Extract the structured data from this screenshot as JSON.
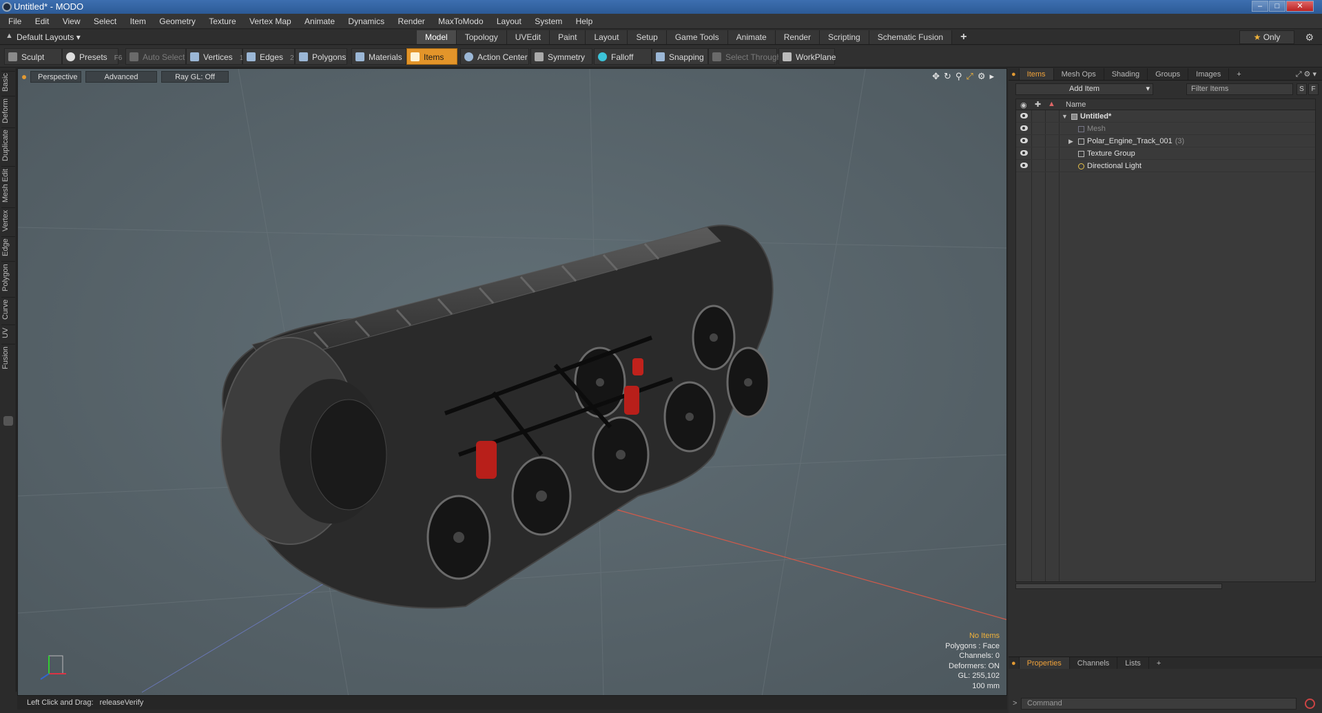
{
  "window": {
    "title": "Untitled* - MODO"
  },
  "menu": [
    "File",
    "Edit",
    "View",
    "Select",
    "Item",
    "Geometry",
    "Texture",
    "Vertex Map",
    "Animate",
    "Dynamics",
    "Render",
    "MaxToModo",
    "Layout",
    "System",
    "Help"
  ],
  "layouts": {
    "dropdown": "Default Layouts",
    "tabs": [
      "Model",
      "Topology",
      "UVEdit",
      "Paint",
      "Layout",
      "Setup",
      "Game Tools",
      "Animate",
      "Render",
      "Scripting",
      "Schematic Fusion"
    ],
    "active": "Model",
    "only": "Only"
  },
  "toolbar": {
    "sculpt": "Sculpt",
    "presets": "Presets",
    "presets_key": "F6",
    "auto_select": "Auto Select",
    "vertices": "Vertices",
    "vertices_key": "1",
    "edges": "Edges",
    "edges_key": "2",
    "polygons": "Polygons",
    "materials": "Materials",
    "items": "Items",
    "action_center": "Action Center",
    "symmetry": "Symmetry",
    "falloff": "Falloff",
    "snapping": "Snapping",
    "select_through": "Select Through",
    "workplane": "WorkPlane"
  },
  "left_tabs": [
    "Basic",
    "Deform",
    "Duplicate",
    "Mesh Edit",
    "Vertex",
    "Edge",
    "Polygon",
    "Curve",
    "UV",
    "Fusion"
  ],
  "viewport": {
    "view": "Perspective",
    "mode": "Advanced",
    "raygl": "Ray GL: Off",
    "info": {
      "selection": "No Items",
      "polygons": "Polygons : Face",
      "channels": "Channels: 0",
      "deformers": "Deformers: ON",
      "gl": "GL: 255,102",
      "scale": "100 mm"
    }
  },
  "status": {
    "hint": "Left Click and Drag:",
    "action": "releaseVerify"
  },
  "panel": {
    "tabs": [
      "Items",
      "Mesh Ops",
      "Shading",
      "Groups",
      "Images",
      "+"
    ],
    "active_tab": "Items",
    "add_item": "Add Item",
    "filter_placeholder": "Filter Items",
    "s_btn": "S",
    "f_btn": "F",
    "column_name": "Name",
    "items": [
      {
        "name": "Untitled*",
        "count": ""
      },
      {
        "name": "Mesh",
        "count": ""
      },
      {
        "name": "Polar_Engine_Track_001",
        "count": "(3)"
      },
      {
        "name": "Texture Group",
        "count": ""
      },
      {
        "name": "Directional Light",
        "count": ""
      }
    ],
    "bottom_tabs": [
      "Properties",
      "Channels",
      "Lists",
      "+"
    ],
    "bottom_active": "Properties",
    "command_placeholder": "Command"
  },
  "colors": {
    "accent": "#e3952a",
    "viewport_bg": "#5a666d",
    "titlebar": "#2c5a96",
    "spring": "#c0221c"
  }
}
